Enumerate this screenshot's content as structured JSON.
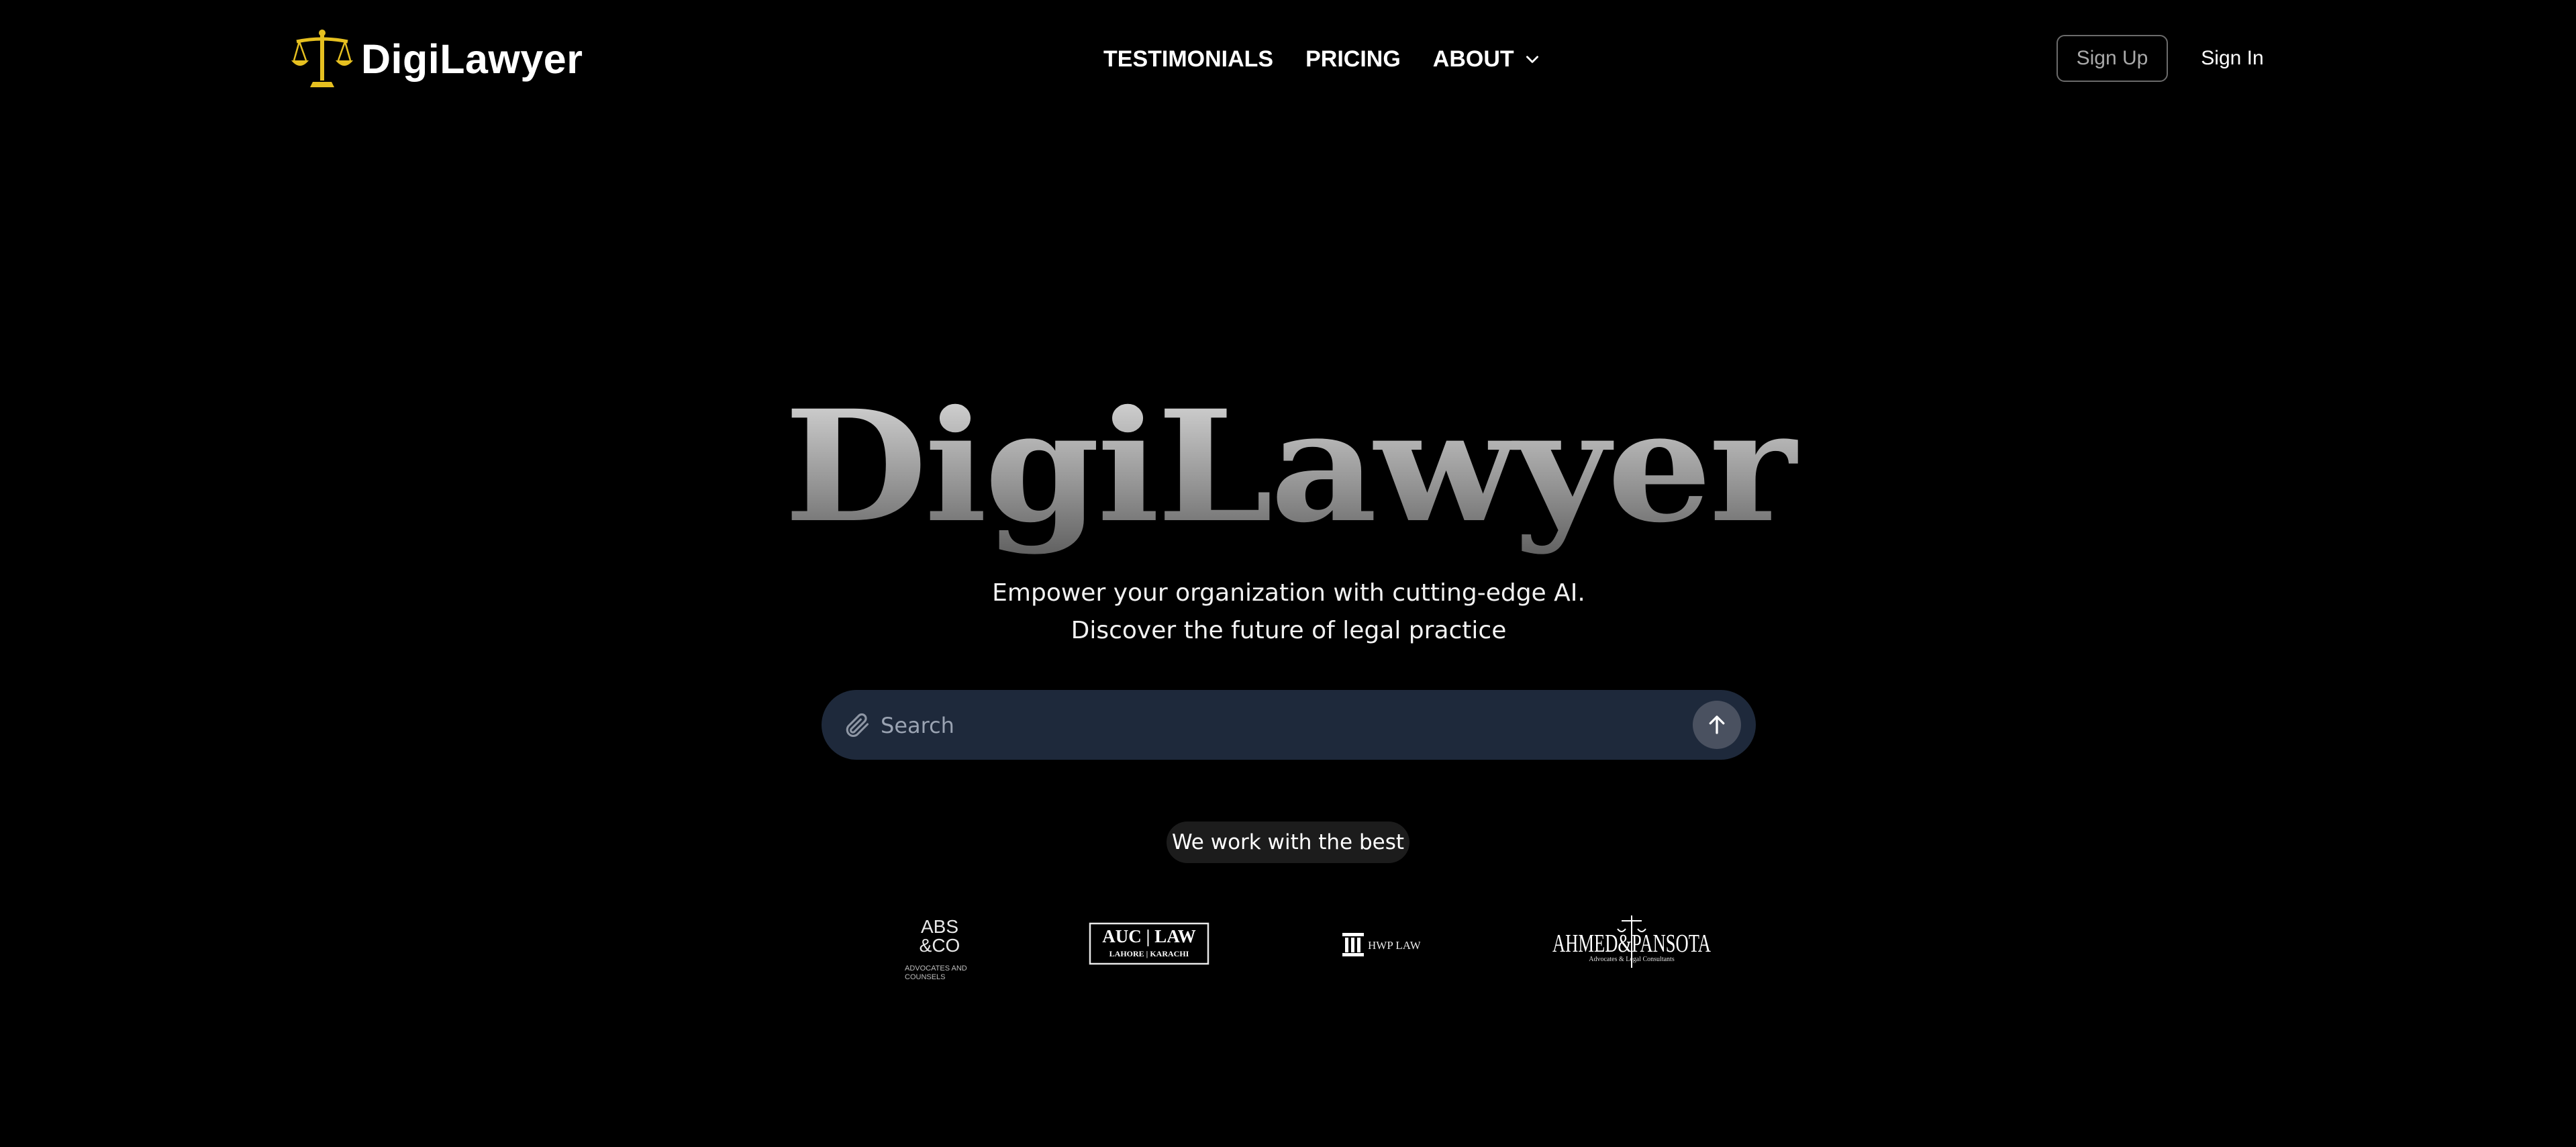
{
  "brand": {
    "name": "DigiLawyer",
    "logo_icon": "scales-of-justice-icon",
    "logo_color": "#e6c020"
  },
  "nav": {
    "items": [
      {
        "label": "TESTIMONIALS"
      },
      {
        "label": "PRICING"
      },
      {
        "label": "ABOUT",
        "icon": "chevron-down-icon"
      }
    ]
  },
  "auth": {
    "sign_up": "Sign Up",
    "sign_in": "Sign In"
  },
  "hero": {
    "title": "DigiLawyer",
    "tagline_line1": "Empower your organization with cutting-edge AI.",
    "tagline_line2": "Discover the future of legal practice"
  },
  "search": {
    "placeholder": "Search",
    "value": "",
    "attach_icon": "paperclip-icon",
    "submit_icon": "arrow-up-icon"
  },
  "partners": {
    "heading": "We work with the best",
    "logos": [
      {
        "name": "ABS & CO",
        "line1": "ABS",
        "line2": "&CO",
        "sub1": "ADVOCATES AND",
        "sub2": "COUNSELS"
      },
      {
        "name": "AUC LAW",
        "line1": "AUC | LAW",
        "sub": "LAHORE | KARACHI"
      },
      {
        "name": "HWP LAW",
        "text": "HWP LAW"
      },
      {
        "name": "AHMED & PANSOTA",
        "text": "AHMED&PANSOTA",
        "sub": "Advocates & Legal Consultants"
      }
    ]
  },
  "colors": {
    "background": "#000000",
    "search_bg": "#1e293b",
    "send_button_bg": "#4a5160",
    "badge_bg": "#1c1c1c"
  }
}
